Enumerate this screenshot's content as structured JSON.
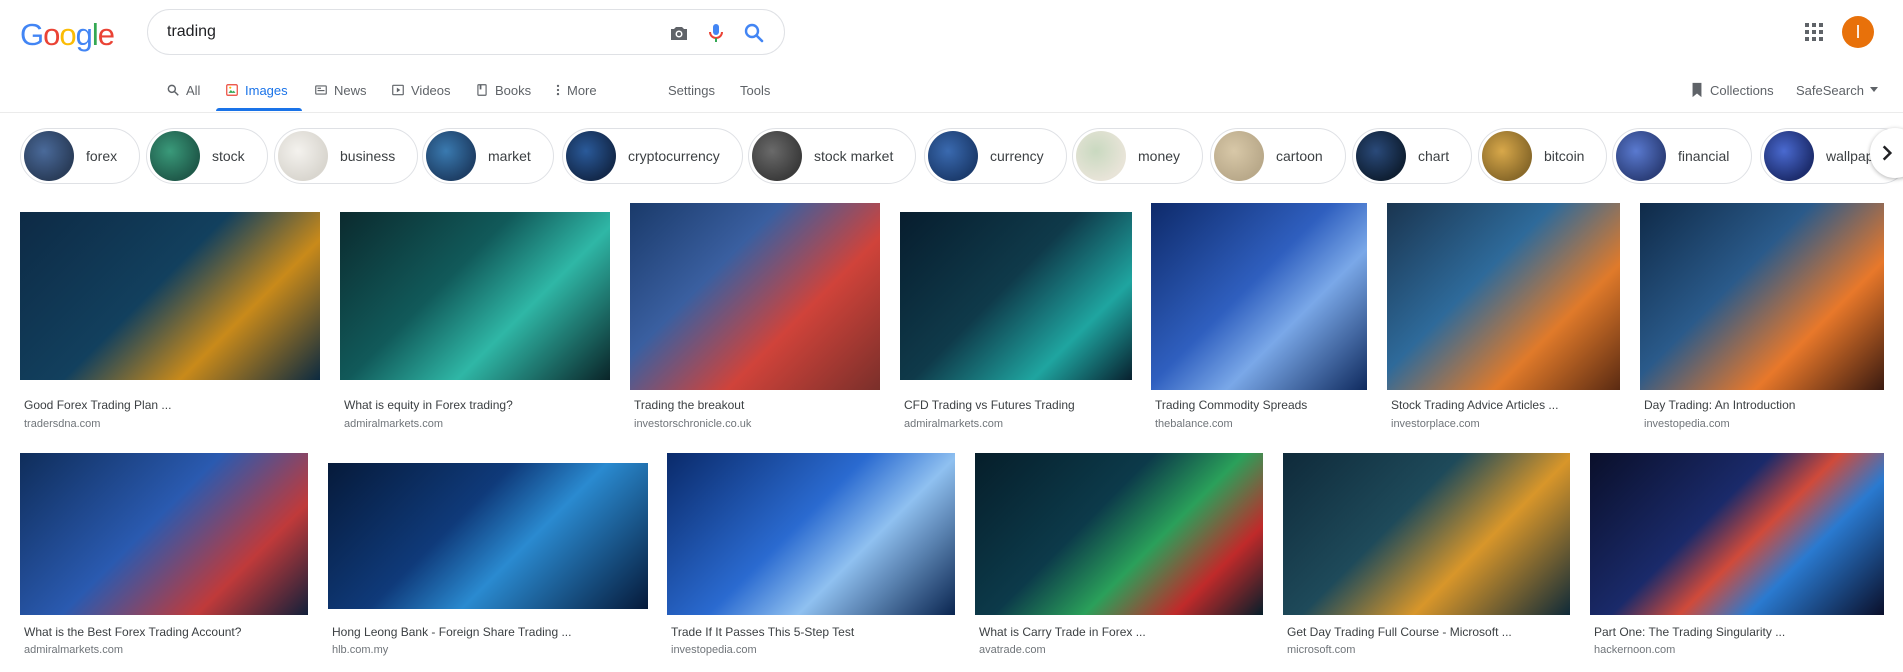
{
  "logo": {
    "letters": [
      "G",
      "o",
      "o",
      "g",
      "l",
      "e"
    ],
    "colors": [
      "#4285f4",
      "#ea4335",
      "#fbbc05",
      "#4285f4",
      "#34a853",
      "#ea4335"
    ]
  },
  "search": {
    "query": "trading"
  },
  "account": {
    "initial": "I",
    "color": "#e8710a"
  },
  "nav": {
    "all": "All",
    "images": "Images",
    "news": "News",
    "videos": "Videos",
    "books": "Books",
    "more": "More",
    "settings": "Settings",
    "tools": "Tools",
    "collections": "Collections",
    "safesearch": "SafeSearch"
  },
  "chips": [
    {
      "label": "forex",
      "color": "#2a3d5a"
    },
    {
      "label": "stock",
      "color": "#1f5a4a"
    },
    {
      "label": "business",
      "color": "#d9d6cf"
    },
    {
      "label": "market",
      "color": "#1e3f66"
    },
    {
      "label": "cryptocurrency",
      "color": "#13294b"
    },
    {
      "label": "stock market",
      "color": "#3b3b3b"
    },
    {
      "label": "currency",
      "color": "#1c3c6e"
    },
    {
      "label": "money",
      "color": "#e8e4d8"
    },
    {
      "label": "cartoon",
      "color": "#b9a98a"
    },
    {
      "label": "chart",
      "color": "#0f1f33"
    },
    {
      "label": "bitcoin",
      "color": "#8a6a2a"
    },
    {
      "label": "financial",
      "color": "#2c3f7a"
    },
    {
      "label": "wallpaper",
      "color": "#1d2d6e"
    }
  ],
  "row1": [
    {
      "title": "Good Forex Trading Plan ...",
      "site": "tradersdna.com",
      "bg": "linear-gradient(135deg,#0d2a45 0%,#12405e 45%,#c98a1a 70%,#0c2a40 100%)"
    },
    {
      "title": "What is equity in Forex trading?",
      "site": "admiralmarkets.com",
      "bg": "linear-gradient(135deg,#0b2a2e 0%,#115a5a 40%,#2fb7a6 65%,#0a2428 100%)"
    },
    {
      "title": "Trading the breakout",
      "site": "investorschronicle.co.uk",
      "bg": "linear-gradient(135deg,#1a3a6a 0%,#3a5fa0 35%,#d0433a 65%,#7a2f2a 100%)"
    },
    {
      "title": "CFD Trading vs Futures Trading",
      "site": "admiralmarkets.com",
      "bg": "linear-gradient(135deg,#071d2e 0%,#0f3a4a 45%,#1fa5a0 75%,#08202e 100%)"
    },
    {
      "title": "Trading Commodity Spreads",
      "site": "thebalance.com",
      "bg": "linear-gradient(135deg,#0e2a6a 0%,#2f5fbf 45%,#7aa8e8 65%,#0f2a5e 100%)"
    },
    {
      "title": "Stock Trading Advice Articles ...",
      "site": "investorplace.com",
      "bg": "linear-gradient(135deg,#1a3550 0%,#2e6a9a 40%,#e07a2a 70%,#5a2a12 100%)"
    },
    {
      "title": "Day Trading: An Introduction",
      "site": "investopedia.com",
      "bg": "linear-gradient(135deg,#0f2a48 0%,#2a5a8a 40%,#e8782a 70%,#3a1a10 100%)"
    }
  ],
  "row2": [
    {
      "title": "What is the Best Forex Trading Account?",
      "site": "admiralmarkets.com",
      "bg": "linear-gradient(135deg,#0f2d5a 0%,#2a5ab0 45%,#c03a3a 75%,#12203a 100%)"
    },
    {
      "title": "Hong Leong Bank - Foreign Share Trading ...",
      "site": "hlb.com.my",
      "bg": "linear-gradient(135deg,#061a3a 0%,#0f3a7a 40%,#2a8ad0 60%,#061a3a 100%)"
    },
    {
      "title": "Trade If It Passes This 5-Step Test",
      "site": "investopedia.com",
      "bg": "linear-gradient(135deg,#0a2a6a 0%,#2a6ad0 45%,#8fc0f0 65%,#0a2550 100%)"
    },
    {
      "title": "What is Carry Trade in Forex ...",
      "site": "avatrade.com",
      "bg": "linear-gradient(135deg,#061e2a 0%,#0c3a4a 40%,#2aa05a 60%,#c02a2a 80%,#061e2a 100%)"
    },
    {
      "title": "Get Day Trading Full Course - Microsoft ...",
      "site": "microsoft.com",
      "bg": "linear-gradient(135deg,#0f2a3a 0%,#1e4a5a 40%,#d8962a 65%,#0f2a38 100%)"
    },
    {
      "title": "Part One: The Trading Singularity ...",
      "site": "hackernoon.com",
      "bg": "linear-gradient(135deg,#0a0f2a 0%,#1a2a6a 40%,#d04a3a 55%,#2a7ad0 70%,#0a0f2a 100%)"
    }
  ]
}
